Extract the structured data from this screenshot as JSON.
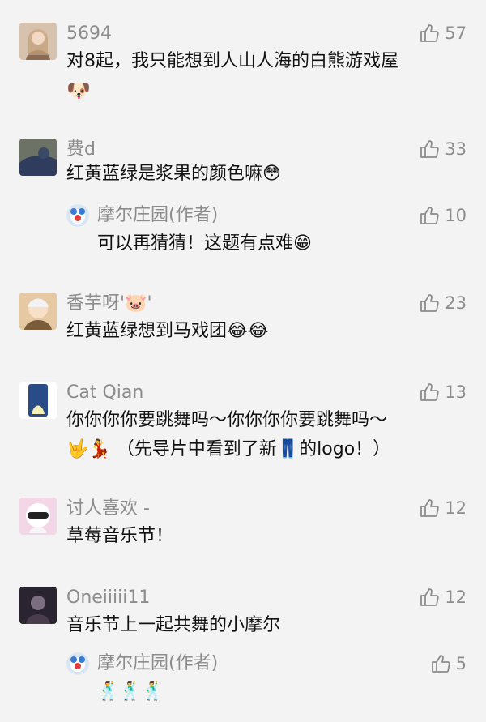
{
  "comments": [
    {
      "user": "5694",
      "likes": "57",
      "lines": [
        "对8起，我只能想到人山人海的白熊游戏屋",
        "🐶"
      ],
      "avatar_colors": [
        "#d7c2ae",
        "#8a6a52"
      ]
    },
    {
      "user": "费d",
      "likes": "33",
      "lines": [
        "红黄蓝绿是浆果的颜色嘛😳"
      ],
      "avatar_colors": [
        "#5b6b5a",
        "#3a4a66"
      ],
      "reply": {
        "user": "摩尔庄园(作者)",
        "likes": "10",
        "text": "可以再猜猜！这题有点难😁"
      }
    },
    {
      "user": "香芋呀'🐷'",
      "likes": "23",
      "lines": [
        "红黄蓝绿想到马戏团😂😂"
      ],
      "avatar_colors": [
        "#e6c8a2",
        "#7a5b3b"
      ]
    },
    {
      "user": "Cat Qian",
      "likes": "13",
      "lines": [
        "你你你你要跳舞吗～你你你你要跳舞吗～",
        "🤟💃 （先导片中看到了新👖的logo！）"
      ],
      "avatar_colors": [
        "#2a4c86",
        "#ffffff"
      ]
    },
    {
      "user": "讨人喜欢 -",
      "likes": "12",
      "lines": [
        "草莓音乐节！"
      ],
      "avatar_colors": [
        "#f3d7e6",
        "#222222"
      ]
    },
    {
      "user": "Oneiiiii11",
      "likes": "12",
      "lines": [
        "音乐节上一起共舞的小摩尔"
      ],
      "avatar_colors": [
        "#2a2430",
        "#7b6f7f"
      ],
      "reply": {
        "user": "摩尔庄园(作者)",
        "likes": "5",
        "text": "🕺🕺🕺"
      }
    }
  ],
  "colors": {
    "background": "#f3f3f3",
    "meta": "#8c8c8c",
    "text": "#111111"
  },
  "icons": {
    "like": "thumbs-up-icon"
  }
}
